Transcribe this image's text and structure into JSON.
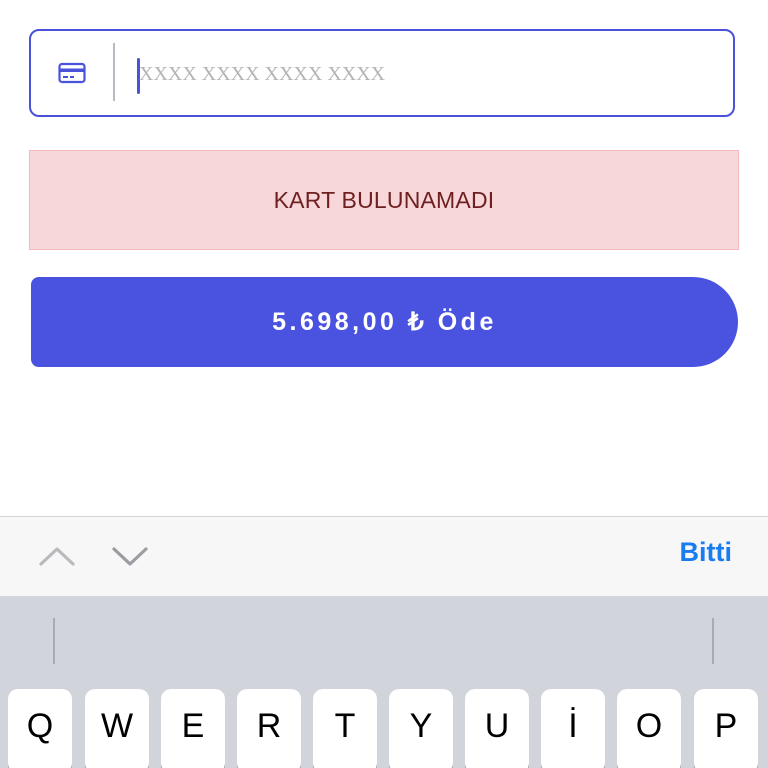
{
  "card_input": {
    "placeholder": "XXXX XXXX XXXX XXXX",
    "value": "",
    "icon": "credit-card-icon"
  },
  "error": {
    "message": "KART BULUNAMADI"
  },
  "pay_button": {
    "label": "5.698,00 ₺ Öde"
  },
  "accessory": {
    "up_icon": "chevron-up-icon",
    "down_icon": "chevron-down-icon",
    "done_label": "Bitti"
  },
  "keyboard": {
    "row1": [
      "Q",
      "W",
      "E",
      "R",
      "T",
      "Y",
      "U",
      "İ",
      "O",
      "P"
    ]
  },
  "colors": {
    "accent": "#4a52e0",
    "error_bg": "#f8d7da",
    "error_text": "#6e2020",
    "done_blue": "#1a7cf1",
    "keyboard_bg": "#d1d5db"
  }
}
